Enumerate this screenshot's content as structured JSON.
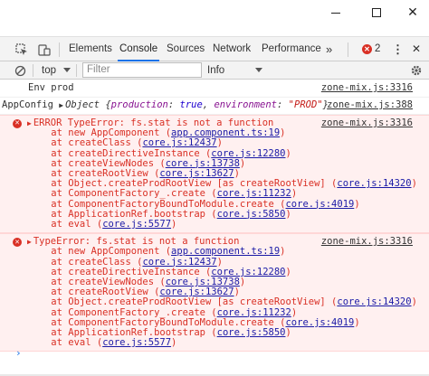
{
  "window": {
    "min_icon": "minimize-icon",
    "max_icon": "maximize-icon",
    "close_glyph": "✕"
  },
  "tabs": {
    "items": [
      "Elements",
      "Console",
      "Sources",
      "Network",
      "Performance"
    ],
    "active": "Console",
    "more_glyph": "»",
    "error_count": "2",
    "menu_glyph": "⋮",
    "close_glyph": "✕"
  },
  "toolbar": {
    "context": "top",
    "filter_placeholder": "Filter",
    "levels": "Info"
  },
  "messages": [
    {
      "type": "log",
      "text": "Env prod",
      "source": "zone-mix.js:3316"
    },
    {
      "type": "log",
      "label": "AppConfig",
      "obj_prefix": "Object {",
      "k1": "production",
      "v1": "true",
      "k2": "environment",
      "v2": "\"PROD\"",
      "obj_suffix": "}",
      "source": "zone-mix.js:388"
    },
    {
      "type": "error",
      "head": "ERROR TypeError: fs.stat is not a function",
      "source": "zone-mix.js:3316",
      "frames": [
        {
          "fn": "    at new AppComponent (",
          "link": "app.component.ts:19",
          "end": ")"
        },
        {
          "fn": "    at createClass (",
          "link": "core.js:12437",
          "end": ")"
        },
        {
          "fn": "    at createDirectiveInstance (",
          "link": "core.js:12280",
          "end": ")"
        },
        {
          "fn": "    at createViewNodes (",
          "link": "core.js:13738",
          "end": ")"
        },
        {
          "fn": "    at createRootView (",
          "link": "core.js:13627",
          "end": ")"
        },
        {
          "fn": "    at Object.createProdRootView [as createRootView] (",
          "link": "core.js:14320",
          "end": ")"
        },
        {
          "fn": "    at ComponentFactory_.create (",
          "link": "core.js:11232",
          "end": ")"
        },
        {
          "fn": "    at ComponentFactoryBoundToModule.create (",
          "link": "core.js:4019",
          "end": ")"
        },
        {
          "fn": "    at ApplicationRef.bootstrap (",
          "link": "core.js:5850",
          "end": ")"
        },
        {
          "fn": "    at eval (",
          "link": "core.js:5577",
          "end": ")"
        }
      ]
    },
    {
      "type": "error",
      "head": "TypeError: fs.stat is not a function",
      "source": "zone-mix.js:3316",
      "frames": [
        {
          "fn": "    at new AppComponent (",
          "link": "app.component.ts:19",
          "end": ")"
        },
        {
          "fn": "    at createClass (",
          "link": "core.js:12437",
          "end": ")"
        },
        {
          "fn": "    at createDirectiveInstance (",
          "link": "core.js:12280",
          "end": ")"
        },
        {
          "fn": "    at createViewNodes (",
          "link": "core.js:13738",
          "end": ")"
        },
        {
          "fn": "    at createRootView (",
          "link": "core.js:13627",
          "end": ")"
        },
        {
          "fn": "    at Object.createProdRootView [as createRootView] (",
          "link": "core.js:14320",
          "end": ")"
        },
        {
          "fn": "    at ComponentFactory_.create (",
          "link": "core.js:11232",
          "end": ")"
        },
        {
          "fn": "    at ComponentFactoryBoundToModule.create (",
          "link": "core.js:4019",
          "end": ")"
        },
        {
          "fn": "    at ApplicationRef.bootstrap (",
          "link": "core.js:5850",
          "end": ")"
        },
        {
          "fn": "    at eval (",
          "link": "core.js:5577",
          "end": ")"
        }
      ]
    }
  ],
  "prompt_glyph": "›",
  "colors": {
    "error_text": "#d93025",
    "error_bg": "#fff0f0",
    "active_tab": "#1a73e8"
  }
}
